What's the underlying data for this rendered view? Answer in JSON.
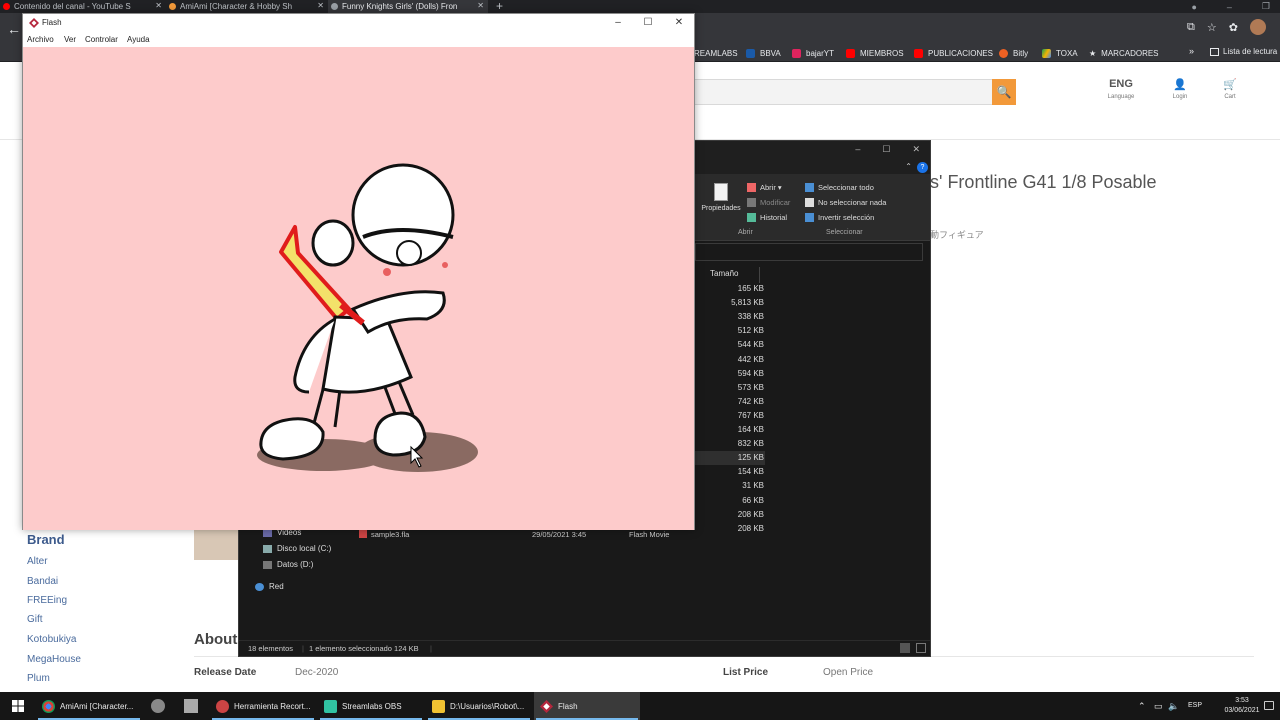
{
  "chrome": {
    "tabs": [
      {
        "label": "Contenido del canal - YouTube S",
        "close": "✕"
      },
      {
        "label": "AmiAmi [Character & Hobby Sh",
        "close": "✕"
      },
      {
        "label": "Funny Knights Girls' (Dolls) Fron",
        "close": "✕"
      }
    ],
    "new_tab": "+",
    "back": "←",
    "bookmarks": [
      {
        "label": "REAMLABS",
        "icon": "streamlabs-icon"
      },
      {
        "label": "BBVA",
        "icon": "bbva-icon"
      },
      {
        "label": "bajarYT",
        "icon": "bajaryt-icon"
      },
      {
        "label": "MIEMBROS",
        "icon": "youtube-icon"
      },
      {
        "label": "PUBLICACIONES",
        "icon": "youtube-icon"
      },
      {
        "label": "Bitly",
        "icon": "bitly-icon"
      },
      {
        "label": "TOXA",
        "icon": "drive-icon"
      },
      {
        "label": "MARCADORES",
        "icon": "star-icon"
      }
    ],
    "bookmarks_more": "»",
    "reading_list": "Lista de lectura"
  },
  "site": {
    "search_icon": "🔍",
    "lang_label": "ENG",
    "lang_sub": "Language",
    "login_sub": "Login",
    "cart_sub": "Cart",
    "product_title": "s' Frontline G41 1/8 Posable",
    "product_subtitle_jp": "動フィギュア",
    "brand_heading": "Brand",
    "brands": [
      "Alter",
      "Bandai",
      "FREEing",
      "Gift",
      "Kotobukiya",
      "MegaHouse",
      "Plum"
    ],
    "about_heading": "About t",
    "release_label": "Release Date",
    "release_value": "Dec-2020",
    "price_label": "List Price",
    "price_value": "Open Price"
  },
  "explorer": {
    "ribbon": {
      "properties": "Propiedades",
      "open": "Abrir",
      "modify": "Modificar",
      "history": "Historial",
      "select_all": "Seleccionar todo",
      "select_none": "No seleccionar nada",
      "invert_selection": "Invertir selección",
      "group_open": "Abrir",
      "group_select": "Seleccionar"
    },
    "column_size": "Tamaño",
    "sizes": [
      "165 KB",
      "5,813 KB",
      "338 KB",
      "512 KB",
      "544 KB",
      "442 KB",
      "594 KB",
      "573 KB",
      "742 KB",
      "767 KB",
      "164 KB",
      "832 KB",
      "125 KB",
      "154 KB",
      "31 KB",
      "66 KB",
      "208 KB",
      "208 KB"
    ],
    "selected_index": 12,
    "nav": {
      "videos": "Videos",
      "disk_c": "Disco local (C:)",
      "data_d": "Datos (D:)",
      "network": "Red"
    },
    "file": {
      "name": "sample3.fla",
      "date": "29/05/2021 3:45",
      "type": "Flash Movie"
    },
    "status_count": "18 elementos",
    "status_selected": "1 elemento seleccionado  124 KB"
  },
  "flash": {
    "title": "Flash",
    "menu": [
      "Archivo",
      "Ver",
      "Controlar",
      "Ayuda"
    ],
    "stage_color": "#fdcbcb"
  },
  "taskbar": {
    "apps": [
      {
        "label": "AmiAmi [Character...",
        "icon": "chrome-icon"
      },
      {
        "label": "Herramienta Recort...",
        "icon": "snipping-tool-icon"
      },
      {
        "label": "Streamlabs OBS",
        "icon": "streamlabs-obs-icon"
      },
      {
        "label": "D:\\Usuarios\\Robot\\...",
        "icon": "folder-icon"
      },
      {
        "label": "Flash",
        "icon": "flash-icon"
      }
    ],
    "language": "ESP",
    "time": "3:53",
    "date": "03/06/2021"
  }
}
